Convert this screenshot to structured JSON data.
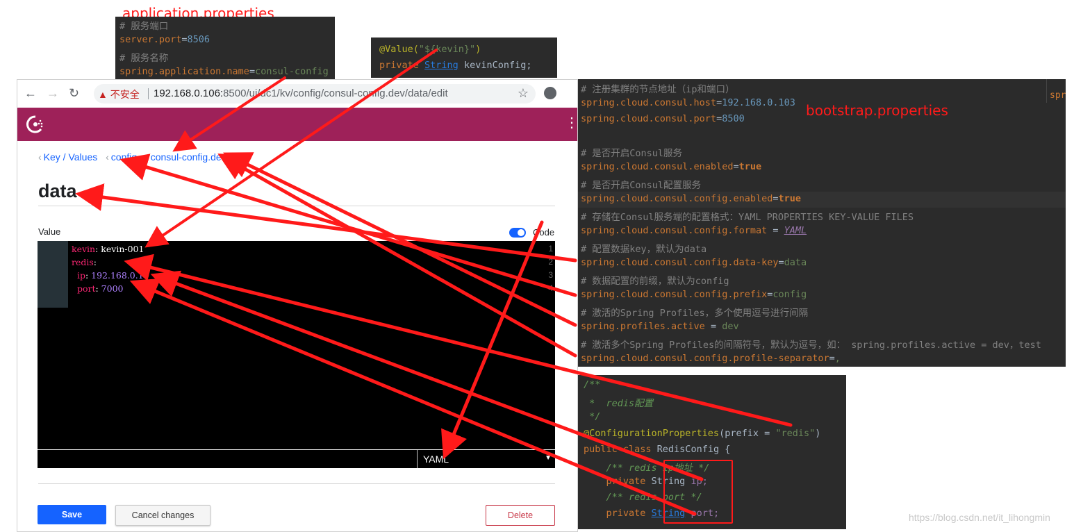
{
  "app_props": {
    "title": "application.properties",
    "lines": [
      {
        "c": "# 服务端口"
      },
      {
        "k": "server.port",
        "eq": "=",
        "v": "8506"
      },
      {
        "c": "# 服务名称"
      },
      {
        "k": "spring.application.name",
        "eq": "=",
        "v": "consul-config"
      }
    ]
  },
  "value_snippet": {
    "line1_a": "@Value(",
    "line1_b": "\"${kevin}\"",
    "line1_c": ")",
    "line2_a": "private ",
    "line2_b": "String",
    "line2_c": " kevinConfig;"
  },
  "bootstrap": {
    "title": "bootstrap.properties",
    "lines": [
      {
        "c": "# 注册集群的节点地址（ip和端口）"
      },
      {
        "k": "spring.cloud.consul.host",
        "eq": "=",
        "v": "192.168.0.103"
      },
      {
        "k": "spring.cloud.consul.port",
        "eq": "=",
        "v": "8500"
      },
      {
        "c": ""
      },
      {
        "c": "# 是否开启Consul服务"
      },
      {
        "k": "spring.cloud.consul.enabled",
        "eq": "=",
        "b": "true"
      },
      {
        "c": "# 是否开启Consul配置服务"
      },
      {
        "k": "spring.cloud.consul.config.enabled",
        "eq": "=",
        "b": "true"
      },
      {
        "c": "# 存储在Consul服务端的配置格式：YAML PROPERTIES KEY-VALUE FILES"
      },
      {
        "k": "spring.cloud.consul.config.format",
        "eq": " = ",
        "v": "YAML"
      },
      {
        "c": "# 配置数据key，默认为data"
      },
      {
        "k": "spring.cloud.consul.config.data-key",
        "eq": "=",
        "v": "data"
      },
      {
        "c": "# 数据配置的前缀，默认为config"
      },
      {
        "k": "spring.cloud.consul.config.prefix",
        "eq": "=",
        "v": "config"
      },
      {
        "c": "# 激活的Spring Profiles，多个使用逗号进行间隔"
      },
      {
        "k": "spring.profiles.active",
        "eq": " = ",
        "v": "dev"
      },
      {
        "c": "# 激活多个Spring Profiles的间隔符号，默认为逗号，如： spring.profiles.active = dev，test"
      },
      {
        "k": "spring.cloud.consul.config.profile-separator",
        "eq": "=",
        "v": ","
      }
    ],
    "corner_text": "spr"
  },
  "redis_class": {
    "l1": "/**",
    "l2": " *  redis配置",
    "l3": " */",
    "l4_ann": "@ConfigurationProperties",
    "l4_mid": "(prefix = ",
    "l4_str": "\"redis\"",
    "l4_end": ")",
    "l5_kw": "public class ",
    "l5_name": "RedisConfig {",
    "l6": "    /** redis ip地址 */",
    "l7_kw": "    private ",
    "l7_type": "String ",
    "l7_var": "ip;",
    "l8": "    /** redis port */",
    "l9_kw": "    private ",
    "l9_type": "String",
    "l9_var": " port;"
  },
  "browser": {
    "warning": "▲ 不安全",
    "url_host": "192.168.0.106:",
    "url_rest": "8500/ui/dc1/kv/config/consul-config.dev/data/edit",
    "breadcrumbs": [
      "Key / Values",
      "config",
      "consul-config.dev"
    ],
    "page_title": "data",
    "value_label": "Value",
    "code_label": "Code",
    "editor_lines": [
      {
        "num": "1",
        "k": "kevin",
        "sep": ": ",
        "v": "kevin-001",
        "num_val": false
      },
      {
        "num": "2",
        "k": "redis",
        "sep": ":",
        "v": "",
        "num_val": false
      },
      {
        "num": "3",
        "k": "  ip",
        "sep": ": ",
        "v": "192.168.0.1",
        "num_val": true
      },
      {
        "num": "4",
        "k": "  port",
        "sep": ": ",
        "v": "7000",
        "num_val": true
      }
    ],
    "syntax": "YAML",
    "save": "Save",
    "cancel": "Cancel changes",
    "delete": "Delete"
  },
  "watermark": "https://blog.csdn.net/it_lihongmin",
  "colors": {
    "consul_header": "#9e2159",
    "accent": "#1563ff",
    "annotation_red": "#ff1a1a"
  }
}
